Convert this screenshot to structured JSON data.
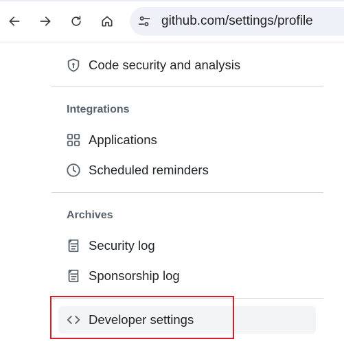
{
  "browser": {
    "url": "github.com/settings/profile"
  },
  "sidebar": {
    "code_security": {
      "label": "Code security and analysis",
      "icon": "shield-icon"
    },
    "integrations": {
      "heading": "Integrations",
      "items": [
        {
          "label": "Applications",
          "icon": "apps-grid-icon"
        },
        {
          "label": "Scheduled reminders",
          "icon": "clock-icon"
        }
      ]
    },
    "archives": {
      "heading": "Archives",
      "items": [
        {
          "label": "Security log",
          "icon": "log-icon"
        },
        {
          "label": "Sponsorship log",
          "icon": "log-icon"
        }
      ]
    },
    "developer_settings": {
      "label": "Developer settings",
      "icon": "code-icon",
      "highlighted": true
    }
  },
  "colors": {
    "highlight_border": "#d0202a",
    "text": "#1f2328",
    "heading": "#59636e",
    "divider": "#d0d7de"
  }
}
